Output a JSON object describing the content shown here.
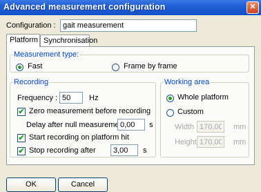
{
  "window": {
    "title": "Advanced measurement configuration",
    "close_glyph": "✕"
  },
  "configuration": {
    "label": "Configuration :",
    "value": "gait measurement"
  },
  "tabs": [
    {
      "label": "Platform",
      "active": true
    },
    {
      "label": "Synchronisation",
      "active": false
    }
  ],
  "measurement_type": {
    "legend": "Measurement type:",
    "options": [
      {
        "label": "Fast",
        "selected": true
      },
      {
        "label": "Frame by frame",
        "selected": false
      }
    ]
  },
  "recording": {
    "legend": "Recording",
    "frequency_label": "Frequency :",
    "frequency_value": "50",
    "frequency_unit": "Hz",
    "zero_measurement": {
      "label": "Zero measurement before recording",
      "checked": true
    },
    "delay_label": "Delay after null measurement",
    "delay_value": "0,00",
    "delay_unit": "s",
    "start_on_hit": {
      "label": "Start recording on platform hit",
      "checked": true
    },
    "stop_after": {
      "label": "Stop recording after",
      "checked": true
    },
    "stop_value": "3,00",
    "stop_unit": "s"
  },
  "working_area": {
    "legend": "Working area",
    "options": [
      {
        "label": "Whole platform",
        "selected": true
      },
      {
        "label": "Custom",
        "selected": false
      }
    ],
    "width_label": "Width",
    "width_value": "170,00",
    "width_unit": "mm",
    "height_label": "Height",
    "height_value": "170,00",
    "height_unit": "mm"
  },
  "buttons": {
    "ok": "OK",
    "cancel": "Cancel"
  },
  "check_glyph": "✔"
}
